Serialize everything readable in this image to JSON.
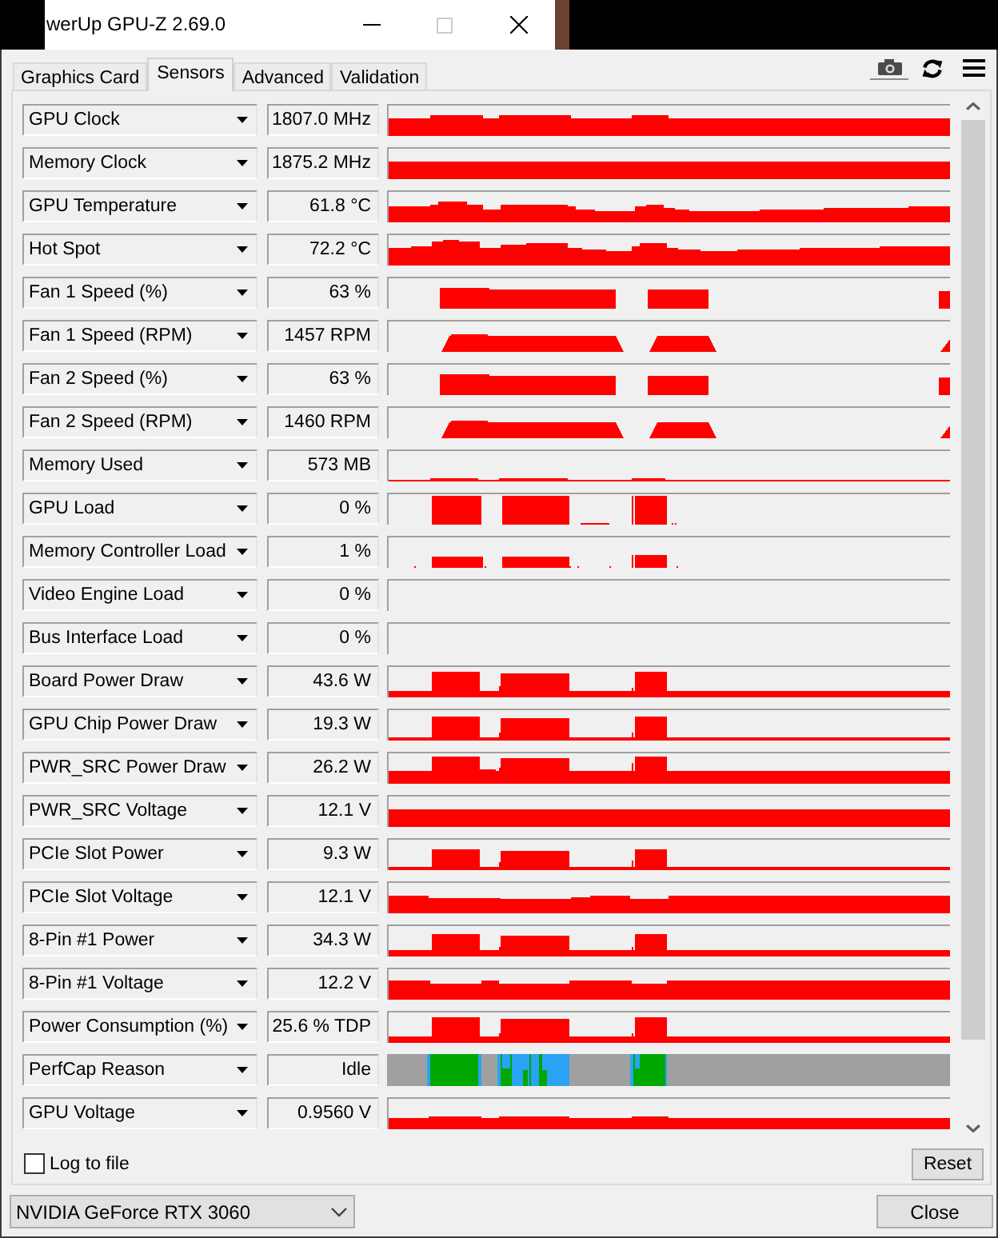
{
  "window": {
    "title": "werUp GPU-Z 2.69.0",
    "maximize_disabled": true
  },
  "tabs": [
    {
      "label": "Graphics Card",
      "selected": false
    },
    {
      "label": "Sensors",
      "selected": true
    },
    {
      "label": "Advanced",
      "selected": false
    },
    {
      "label": "Validation",
      "selected": false
    }
  ],
  "sensors": [
    {
      "name": "GPU Clock",
      "value": "1807.0 MHz",
      "kind": "graph"
    },
    {
      "name": "Memory Clock",
      "value": "1875.2 MHz",
      "kind": "graph"
    },
    {
      "name": "GPU Temperature",
      "value": "61.8 °C",
      "kind": "graph"
    },
    {
      "name": "Hot Spot",
      "value": "72.2 °C",
      "kind": "graph"
    },
    {
      "name": "Fan 1 Speed (%)",
      "value": "63 %",
      "kind": "graph"
    },
    {
      "name": "Fan 1 Speed (RPM)",
      "value": "1457 RPM",
      "kind": "graph"
    },
    {
      "name": "Fan 2 Speed (%)",
      "value": "63 %",
      "kind": "graph"
    },
    {
      "name": "Fan 2 Speed (RPM)",
      "value": "1460 RPM",
      "kind": "graph"
    },
    {
      "name": "Memory Used",
      "value": "573 MB",
      "kind": "graph"
    },
    {
      "name": "GPU Load",
      "value": "0 %",
      "kind": "graph"
    },
    {
      "name": "Memory Controller Load",
      "value": "1 %",
      "kind": "graph"
    },
    {
      "name": "Video Engine Load",
      "value": "0 %",
      "kind": "graph"
    },
    {
      "name": "Bus Interface Load",
      "value": "0 %",
      "kind": "graph"
    },
    {
      "name": "Board Power Draw",
      "value": "43.6 W",
      "kind": "graph"
    },
    {
      "name": "GPU Chip Power Draw",
      "value": "19.3 W",
      "kind": "graph"
    },
    {
      "name": "PWR_SRC Power Draw",
      "value": "26.2 W",
      "kind": "graph"
    },
    {
      "name": "PWR_SRC Voltage",
      "value": "12.1 V",
      "kind": "graph"
    },
    {
      "name": "PCIe Slot Power",
      "value": "9.3 W",
      "kind": "graph"
    },
    {
      "name": "PCIe Slot Voltage",
      "value": "12.1 V",
      "kind": "graph"
    },
    {
      "name": "8-Pin #1 Power",
      "value": "34.3 W",
      "kind": "graph"
    },
    {
      "name": "8-Pin #1 Voltage",
      "value": "12.2 V",
      "kind": "graph"
    },
    {
      "name": "Power Consumption (%)",
      "value": "25.6 % TDP",
      "kind": "graph"
    },
    {
      "name": "PerfCap Reason",
      "value": "Idle",
      "kind": "status"
    },
    {
      "name": "GPU Voltage",
      "value": "0.9560 V",
      "kind": "graph"
    }
  ],
  "log_to_file": {
    "label": "Log to file",
    "checked": false
  },
  "reset_button": {
    "label": "Reset"
  },
  "gpu_select": {
    "value": "NVIDIA GeForce RTX 3060"
  },
  "close_button": {
    "label": "Close"
  }
}
